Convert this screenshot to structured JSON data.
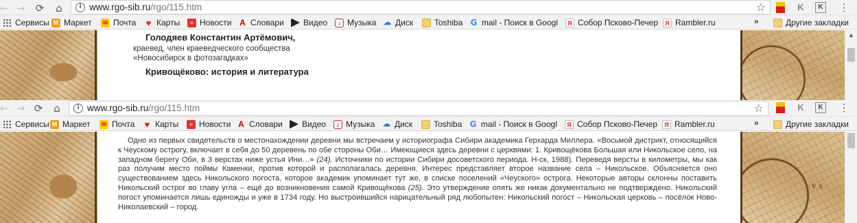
{
  "browser": {
    "url_host": "www.rgo-sib.ru",
    "url_path": "/rgo/115.htm",
    "bookmarks": [
      {
        "label": "Сервисы",
        "icon": "apps-grid-icon"
      },
      {
        "label": "Маркет",
        "icon": "market-icon"
      },
      {
        "label": "Почта",
        "icon": "mail-icon"
      },
      {
        "label": "Карты",
        "icon": "map-pin-icon"
      },
      {
        "label": "Новости",
        "icon": "news-icon"
      },
      {
        "label": "Словари",
        "icon": "dictionary-icon"
      },
      {
        "label": "Видео",
        "icon": "video-icon"
      },
      {
        "label": "Музыка",
        "icon": "music-icon"
      },
      {
        "label": "Диск",
        "icon": "disk-icon"
      },
      {
        "label": "Toshiba",
        "icon": "folder-icon"
      },
      {
        "label": "mail - Поиск в Googl",
        "icon": "google-icon"
      },
      {
        "label": "Собор Псково-Печер",
        "icon": "yandex-icon"
      },
      {
        "label": "Rambler.ru",
        "icon": "yandex-icon"
      }
    ],
    "more_label": "»",
    "other_bookmarks": "Другие закладки"
  },
  "shot1": {
    "author_name": "Голодяев Константин Артёмович,",
    "author_role": "краевед, член краеведческого сообщества",
    "author_org": "«Новосибирск в фотозагадках»",
    "article_title": "Кривощёково: история и литература"
  },
  "shot2": {
    "paragraph_part1": "Одно из первых свидетельств о местонахождении деревни мы встречаем у историографа Сибири академика Герхарда Миллера. «Восьмой дистрикт, относящийся к Чеускому острогу, включает в себя до 50 деревень по обе стороны Оби… Имеющиеся здесь деревни с церквями: 1. Кривощёкова Большая или Никольское село, на западном берегу Оби, в 3 верстах ниже устья Ини…» ",
    "ref1": "(24).",
    "paragraph_part2": " Источники по истории Сибири досоветского периода. Н-ск, 1988). Переведя версты в километры, мы как раз получим место поймы Каменки, против которой и располагалась деревня. Интерес представляет второе название села – Никольское. Объясняется оно существованием здесь Никольского погоста, которое академик упоминает тут же, в списке поселений «Чеуского» острога. Некоторые авторы склонны поставить Никольский острог во главу угла – ещё до возникновения самой Кривощёкова ",
    "ref2": "(25).",
    "paragraph_part3": " Это утверждение опять же никак документально не подтверждено. Никольский погост упоминается лишь единожды и уже в 1734 году. Но выстроившийся нарицательный ряд любопытен: Никольский погост – Никольская церковь – посёлок Ново-Николаевский – город."
  },
  "map_label": "V S ."
}
